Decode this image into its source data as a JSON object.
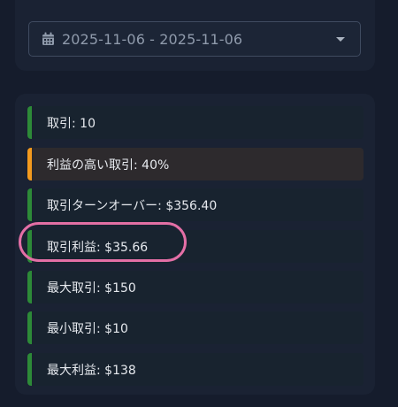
{
  "date_range": {
    "value": "2025-11-06 - 2025-11-06"
  },
  "stats": [
    {
      "label": "取引: 10",
      "status": "normal"
    },
    {
      "label": "利益の高い取引: 40%",
      "status": "warning"
    },
    {
      "label": "取引ターンオーバー: $356.40",
      "status": "normal"
    },
    {
      "label": "取引利益: $35.66",
      "status": "normal"
    },
    {
      "label": "最大取引: $150",
      "status": "normal"
    },
    {
      "label": "最小取引: $10",
      "status": "normal"
    },
    {
      "label": "最大利益: $138",
      "status": "normal"
    }
  ],
  "colors": {
    "normal_accent": "#2d8a38",
    "warning_accent": "#f39a1e",
    "highlight": "#e46fa6"
  }
}
